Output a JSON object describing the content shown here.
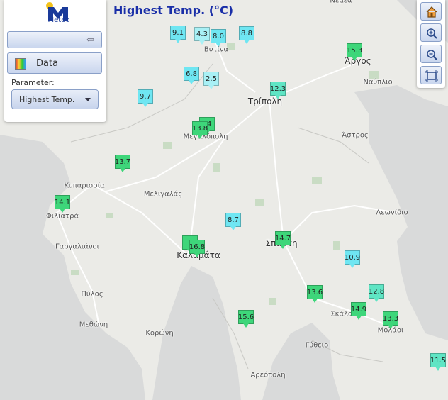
{
  "title": "Highest Temp. (°C)",
  "logo_text": "Meteo",
  "panel": {
    "data_tab_label": "Data",
    "parameter_label": "Parameter:",
    "parameter_value": "Highest Temp."
  },
  "toolbar": [
    "home-icon",
    "zoom-in-icon",
    "zoom-out-icon",
    "fullscreen-icon"
  ],
  "colors": {
    "cyan": "#6fe6f2",
    "teal": "#5fe5c4",
    "green": "#3ed67a",
    "light_cyan": "#a8f0f5",
    "title": "#1a2fa8"
  },
  "places": [
    {
      "name": "Νεμέα"
    },
    {
      "name": "Βυτίνα"
    },
    {
      "name": "Άργος"
    },
    {
      "name": "Ναύπλιο"
    },
    {
      "name": "Τρίπολη"
    },
    {
      "name": "Μεγαλόπολη"
    },
    {
      "name": "Άστρος"
    },
    {
      "name": "Κυπαρισσία"
    },
    {
      "name": "Μελιγαλάς"
    },
    {
      "name": "Φιλιατρά"
    },
    {
      "name": "Λεωνίδιο"
    },
    {
      "name": "Γαργαλιάνοι"
    },
    {
      "name": "Καλαμάτα"
    },
    {
      "name": "Σπάρτη"
    },
    {
      "name": "Πύλος"
    },
    {
      "name": "Σκάλα"
    },
    {
      "name": "Μεθώνη"
    },
    {
      "name": "Μολάοι"
    },
    {
      "name": "Κορώνη"
    },
    {
      "name": "Γύθειο"
    },
    {
      "name": "Αρεόπολη"
    }
  ],
  "stations": [
    {
      "value": "9.1",
      "tone": "cyan"
    },
    {
      "value": "4.3",
      "tone": "light_cyan"
    },
    {
      "value": "8.0",
      "tone": "cyan"
    },
    {
      "value": "8.8",
      "tone": "cyan"
    },
    {
      "value": "15.3",
      "tone": "green"
    },
    {
      "value": "6.8",
      "tone": "cyan"
    },
    {
      "value": "2.5",
      "tone": "light_cyan"
    },
    {
      "value": "12.3",
      "tone": "teal"
    },
    {
      "value": "9.7",
      "tone": "cyan"
    },
    {
      "value": "14",
      "tone": "green"
    },
    {
      "value": "13.8",
      "tone": "green"
    },
    {
      "value": "13.7",
      "tone": "green"
    },
    {
      "value": "14.1",
      "tone": "green"
    },
    {
      "value": "8.7",
      "tone": "cyan"
    },
    {
      "value": "14.7",
      "tone": "green"
    },
    {
      "value": "1",
      "tone": "green"
    },
    {
      "value": "16.8",
      "tone": "green"
    },
    {
      "value": "10.9",
      "tone": "cyan"
    },
    {
      "value": "13.6",
      "tone": "green"
    },
    {
      "value": "12.8",
      "tone": "teal"
    },
    {
      "value": "14.9",
      "tone": "green"
    },
    {
      "value": "15.6",
      "tone": "green"
    },
    {
      "value": "13.3",
      "tone": "green"
    },
    {
      "value": "11.5",
      "tone": "teal"
    }
  ]
}
